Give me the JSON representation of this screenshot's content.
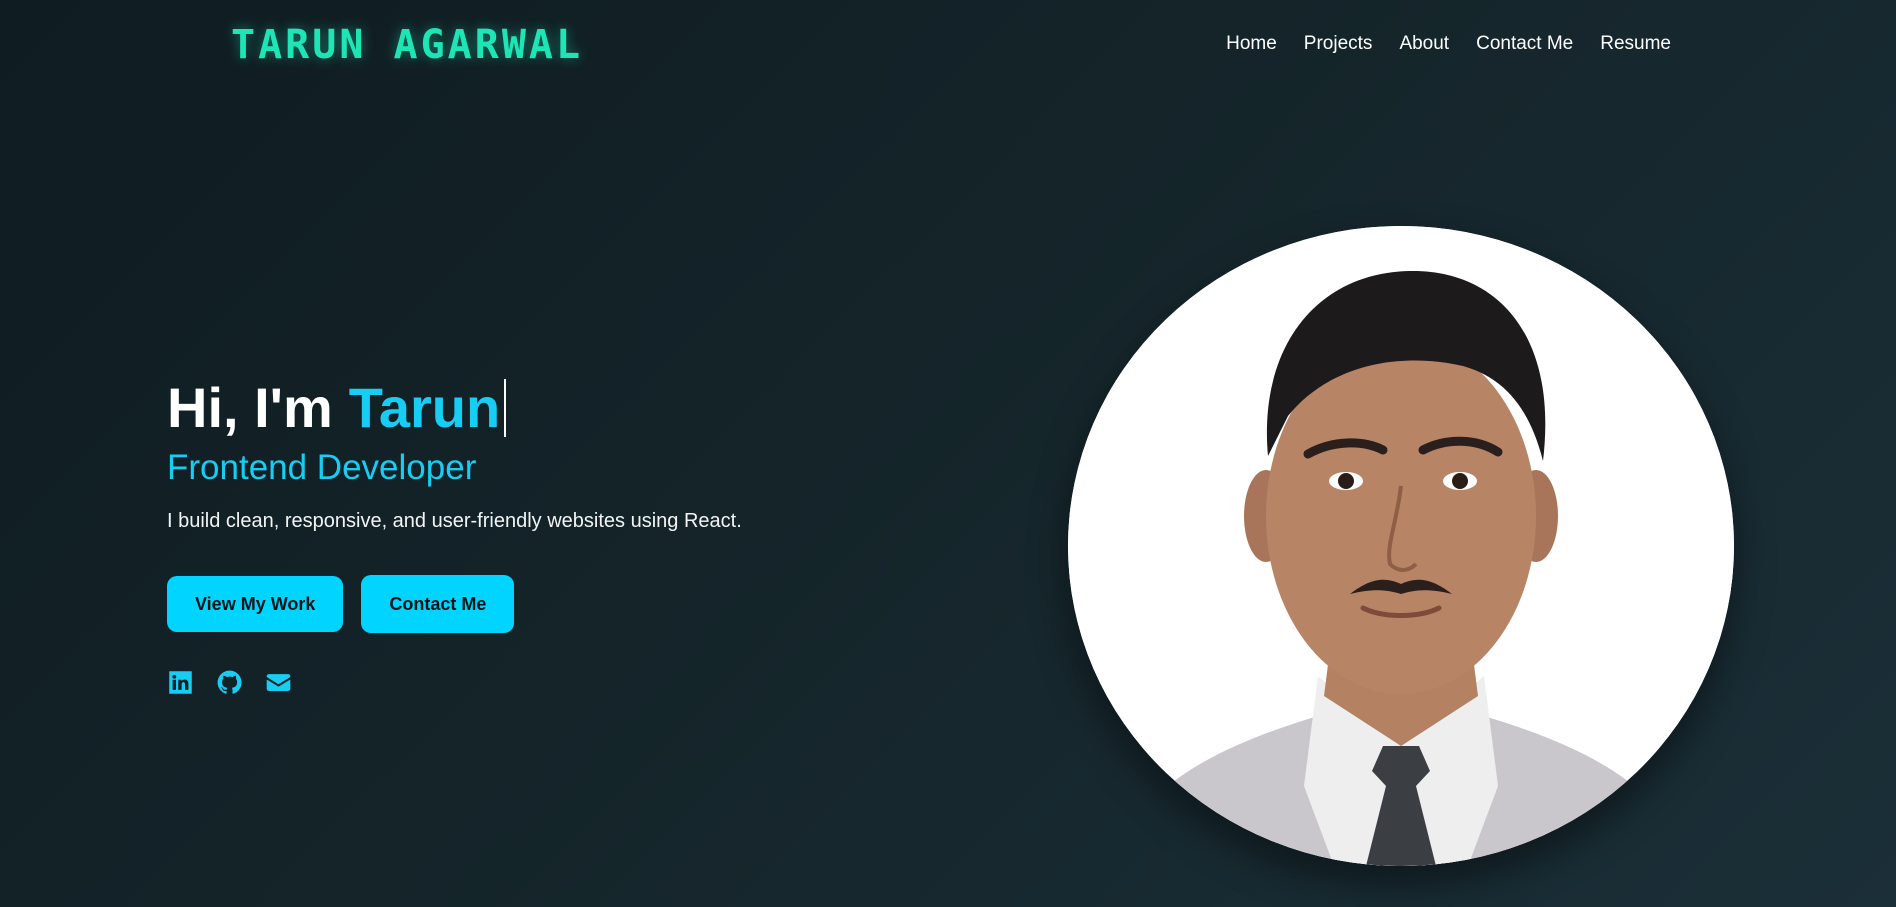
{
  "header": {
    "logo": "TARUN AGARWAL",
    "nav": [
      "Home",
      "Projects",
      "About",
      "Contact Me",
      "Resume"
    ]
  },
  "hero": {
    "greeting_prefix": "Hi, I'm",
    "name": "Tarun",
    "role": "Frontend Developer",
    "tagline": "I build clean, responsive, and user-friendly websites using React.",
    "buttons": {
      "primary": "View My Work",
      "secondary": "Contact Me"
    },
    "socials": [
      "linkedin-icon",
      "github-icon",
      "email-icon"
    ]
  },
  "colors": {
    "accent": "#17cdf4",
    "logo": "#1ee5b6",
    "button": "#00d4ff",
    "background": "#142429"
  }
}
